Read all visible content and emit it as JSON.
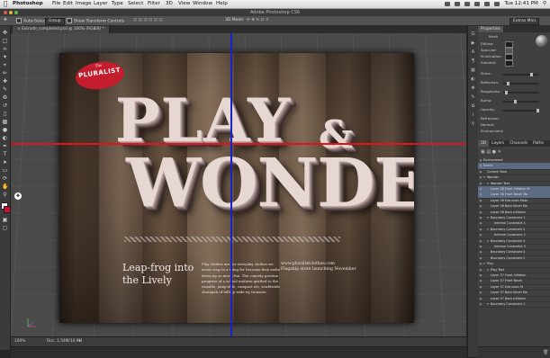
{
  "menubar": {
    "app": "Photoshop",
    "items": [
      "File",
      "Edit",
      "Image",
      "Layer",
      "Type",
      "Select",
      "Filter",
      "3D",
      "View",
      "Window",
      "Help"
    ],
    "clock": "Tue 12:41 PM"
  },
  "window": {
    "title": "Adobe Photoshop CS6"
  },
  "options": {
    "auto_select": "Auto-Select:",
    "auto_select_value": "Group",
    "show_transform": "Show Transform Controls",
    "mode_3d": "3D Mode:",
    "workspace": "Extras Mini"
  },
  "document": {
    "tab_label": "Extrude_completed.psd @ 100% (RGB/8) *",
    "zoom": "100%",
    "doc_info": "Doc: 1.54M/14.9M"
  },
  "artwork": {
    "logo_by": "The",
    "logo_name": "PLURALIST",
    "word1": "PLAY",
    "ampersand": "&",
    "word2": "WONDER",
    "headline": "Leap-frog into the Lively",
    "body": "Play clothes are for everyday clothes we never stop to a thing for because they make dress up so much fun. The comedy pristine progress of a school uniform grafted to the runable, jump-able, compact etc, worldwide chutzpah of hilltop wide-eg trousers.",
    "url": "www.pluralistclothes.com",
    "flagship": "Flagship store launching November"
  },
  "panels": {
    "properties_title": "Properties",
    "props_subtitle": "Mesh",
    "rows": [
      "Diffuse:",
      "Specular:",
      "Illumination:",
      "Ambient:",
      "Shine:",
      "Reflection:",
      "Roughness:",
      "Bump:",
      "Opacity:",
      "Refraction:",
      "Normal:",
      "Environment:"
    ],
    "tabs": [
      "3D",
      "Layers",
      "Channels",
      "Paths"
    ],
    "filter_labels": [
      "Environment",
      "Scene",
      "Current View"
    ],
    "layers": [
      "Wonder",
      "Wonder Text",
      "Layer 38 Front Inflation M",
      "Layer 38 Front Bevel Ma",
      "Layer 38 Extrusion Mate",
      "Layer 38 Back Bevel Ma",
      "Layer 38 Back Inflation",
      "Boundary Constraint 1",
      "Internal Constraint 1",
      "Boundary Constraint 2",
      "Internal Constraint 2",
      "Boundary Constraint 3",
      "Internal Constraint 3",
      "Boundary Constraint 4",
      "Boundary Constraint 5",
      "Play",
      "Play Text",
      "Layer 37 Front Inflation",
      "Layer 37 Front Bevel",
      "Layer 37 Extrusion M",
      "Layer 37 Back Bevel Ma",
      "Layer 37 Back Inflation",
      "Boundary Constraint 1"
    ]
  },
  "colors": {
    "guide_horizontal": "#e1141e",
    "guide_vertical": "#1722c8",
    "logo_red": "#c41e2e",
    "selection_blue": "#5c6a84"
  }
}
